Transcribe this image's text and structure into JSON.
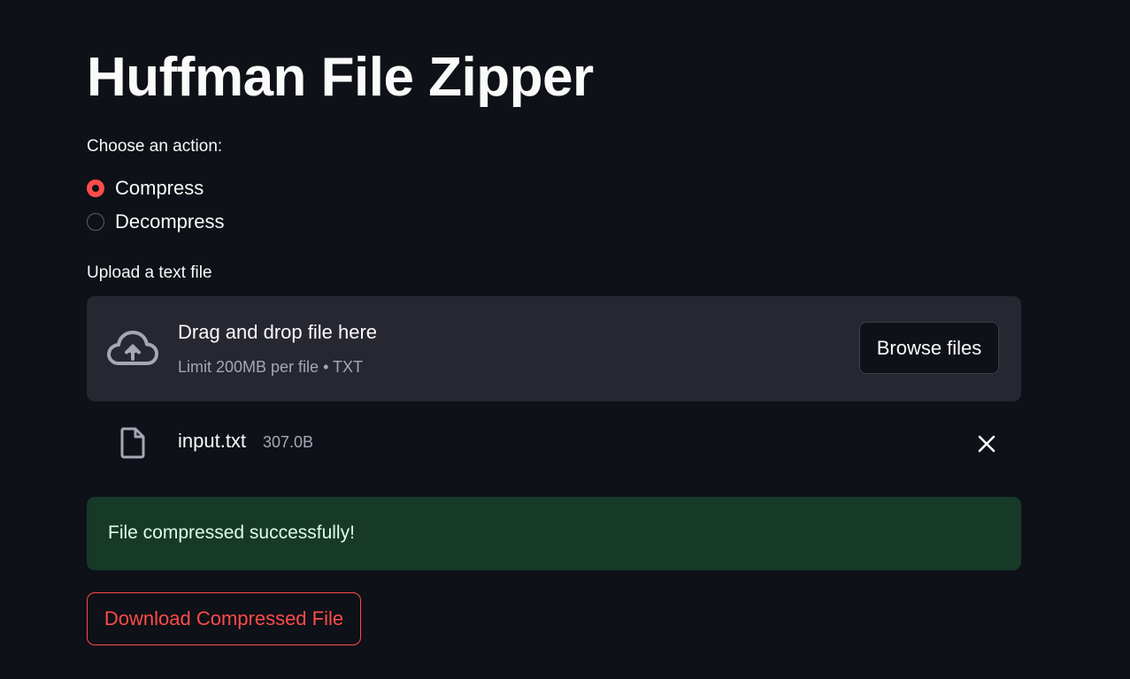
{
  "page": {
    "title": "Huffman File Zipper"
  },
  "action": {
    "label": "Choose an action:",
    "options": [
      {
        "label": "Compress",
        "selected": true
      },
      {
        "label": "Decompress",
        "selected": false
      }
    ]
  },
  "uploader": {
    "label": "Upload a text file",
    "dropzone_title": "Drag and drop file here",
    "dropzone_limit": "Limit 200MB per file • TXT",
    "browse_label": "Browse files",
    "cloud_icon": "cloud-upload-icon"
  },
  "uploaded_file": {
    "name": "input.txt",
    "size": "307.0B",
    "file_icon": "file-icon",
    "remove_icon": "close-icon"
  },
  "status": {
    "message": "File compressed successfully!"
  },
  "download": {
    "label": "Download Compressed File"
  },
  "colors": {
    "background": "#0e1117",
    "accent": "#ff4b4b",
    "dropzone_bg": "#262730",
    "success_bg": "#173928",
    "success_text": "#dffde9",
    "muted_text": "#a3a8b4"
  }
}
